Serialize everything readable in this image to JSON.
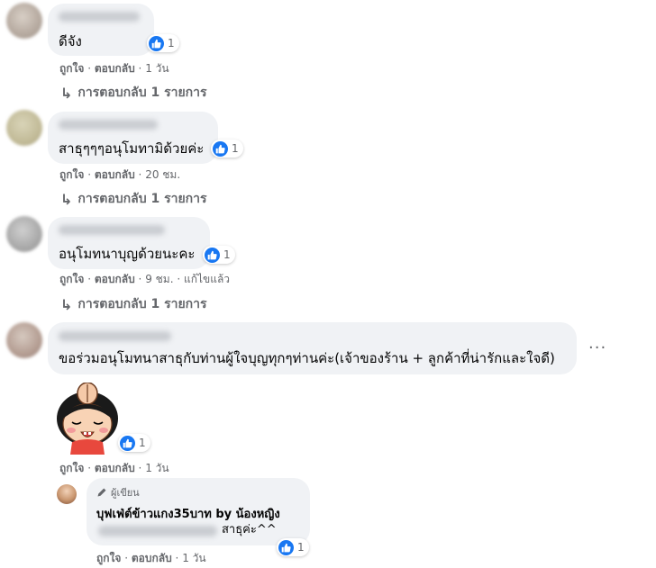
{
  "comments": [
    {
      "text": "ดีจัง",
      "likes": "1",
      "actions": {
        "like": "ถูกใจ",
        "reply": "ตอบกลับ",
        "time": "1 วัน"
      },
      "replies_label": "การตอบกลับ 1 รายการ"
    },
    {
      "text": "สาธุๆๆๆอนุโมทามิด้วยค่ะ",
      "likes": "1",
      "actions": {
        "like": "ถูกใจ",
        "reply": "ตอบกลับ",
        "time": "20 ชม."
      },
      "replies_label": "การตอบกลับ 1 รายการ"
    },
    {
      "text": "อนุโมทนาบุญด้วยนะคะ",
      "likes": "1",
      "actions": {
        "like": "ถูกใจ",
        "reply": "ตอบกลับ",
        "time": "9 ชม.",
        "edited": "แก้ไขแล้ว"
      },
      "replies_label": "การตอบกลับ 1 รายการ"
    },
    {
      "text": "ขอร่วมอนุโมทนาสาธุกับท่านผู้ใจบุญทุกๆท่านค่ะ(เจ้าของร้าน + ลูกค้าที่น่ารักและใจดี)",
      "likes": "1",
      "actions": {
        "like": "ถูกใจ",
        "reply": "ตอบกลับ",
        "time": "1 วัน"
      }
    }
  ],
  "reply": {
    "badge": "ผู้เขียน",
    "author": "บุฟเฟ่ต์ข้าวแกง35บาท by น้องหญิง",
    "text": "สาธุค่ะ^^",
    "likes": "1",
    "actions": {
      "like": "ถูกใจ",
      "reply": "ตอบกลับ",
      "time": "1 วัน"
    }
  },
  "more_menu": "···",
  "colors": {
    "bubble": "#f0f2f5",
    "like_blue": "#1877f2",
    "meta_gray": "#65676b"
  }
}
